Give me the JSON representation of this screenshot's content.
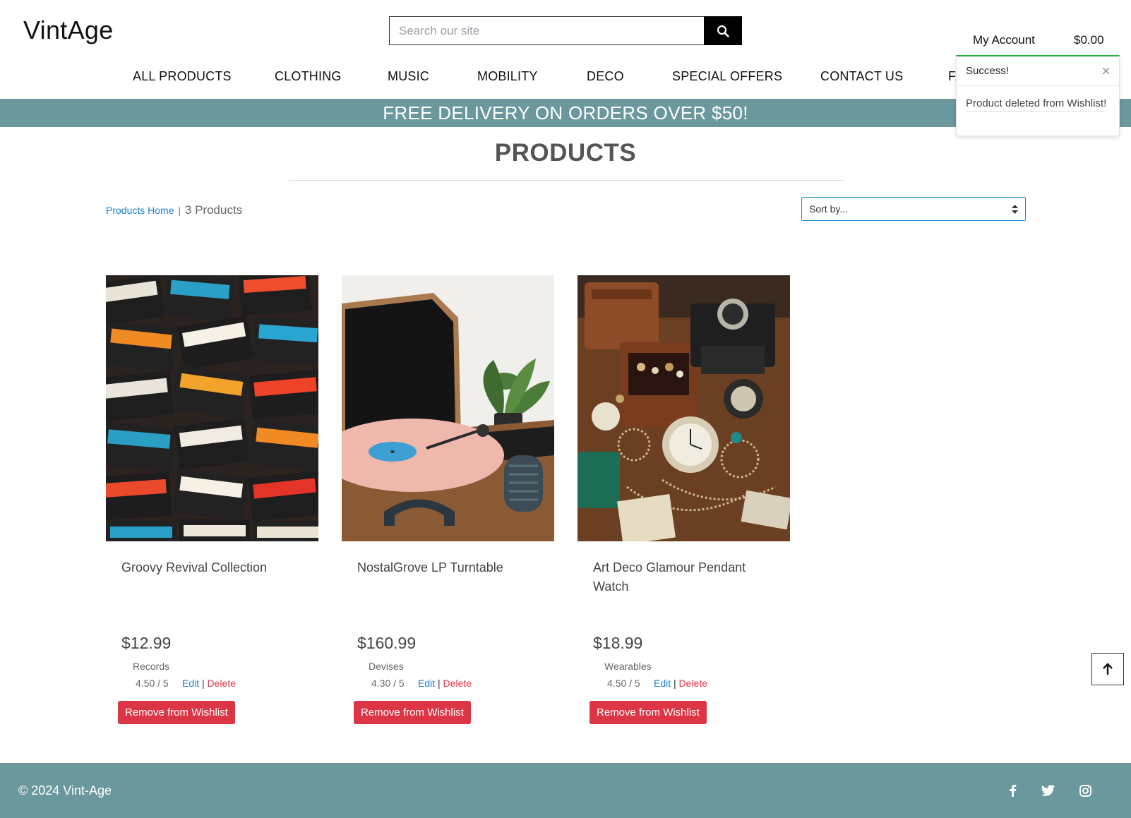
{
  "header": {
    "logo": "VintAge",
    "search_placeholder": "Search our site",
    "account_label": "My Account",
    "cart_total": "$0.00"
  },
  "nav": {
    "items": [
      "ALL PRODUCTS",
      "CLOTHING",
      "MUSIC",
      "MOBILITY",
      "DECO",
      "SPECIAL OFFERS",
      "CONTACT US",
      "FAQ"
    ]
  },
  "banner": {
    "text": "FREE DELIVERY ON ORDERS OVER $50!"
  },
  "toast": {
    "title": "Success!",
    "message": "Product deleted from Wishlist!",
    "close_icon": "×",
    "accent": "#28a745"
  },
  "page": {
    "title": "PRODUCTS",
    "breadcrumb_link": "Products Home",
    "separator": "|",
    "product_count": "3 Products",
    "sort_placeholder": "Sort by..."
  },
  "products": [
    {
      "name": "Groovy Revival Collection",
      "price": "$12.99",
      "category": "Records",
      "rating": "4.50 / 5",
      "edit": "Edit",
      "sep": "|",
      "delete": "Delete",
      "remove": "Remove from Wishlist",
      "image": "cassette-tapes"
    },
    {
      "name": "NostalGrove LP Turntable",
      "price": "$160.99",
      "category": "Devises",
      "rating": "4.30 / 5",
      "edit": "Edit",
      "sep": "|",
      "delete": "Delete",
      "remove": "Remove from Wishlist",
      "image": "record-player"
    },
    {
      "name": "Art Deco Glamour Pendant Watch",
      "price": "$18.99",
      "category": "Wearables",
      "rating": "4.50 / 5",
      "edit": "Edit",
      "sep": "|",
      "delete": "Delete",
      "remove": "Remove from Wishlist",
      "image": "vintage-jewelry"
    }
  ],
  "footer": {
    "copyright": "© 2024 Vint-Age",
    "social": [
      "facebook-icon",
      "twitter-icon",
      "instagram-icon"
    ]
  },
  "colors": {
    "banner": "#6a989c",
    "danger": "#dc3545",
    "link": "#1a7fd9"
  }
}
